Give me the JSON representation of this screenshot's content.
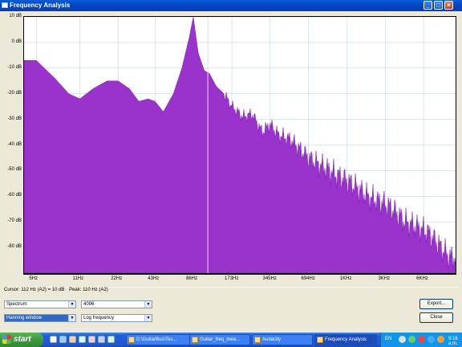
{
  "window": {
    "title": "Frequency Analysis"
  },
  "title_buttons": {
    "minimize": "_",
    "maximize": "□",
    "close": "×"
  },
  "chart_data": {
    "type": "area",
    "y_ticks": [
      "10 dB",
      "0 dB",
      "-10 dB",
      "-20 dB",
      "-30 dB",
      "-40 dB",
      "-50 dB",
      "-60 dB",
      "-70 dB",
      "-80 dB"
    ],
    "x_ticks": [
      "5Hz",
      "11Hz",
      "22Hz",
      "43Hz",
      "86Hz",
      "173Hz",
      "345Hz",
      "694Hz",
      "1KHz",
      "3KHz",
      "6KHz"
    ],
    "ylim": [
      -90,
      10
    ],
    "x_scale": "log",
    "fill_color": "#9933cc",
    "grid": true,
    "cursor_hz": 112,
    "spectrum_envelope_db": [
      [
        5,
        -7
      ],
      [
        7,
        -14
      ],
      [
        9,
        -20
      ],
      [
        11,
        -22
      ],
      [
        14,
        -18
      ],
      [
        18,
        -15
      ],
      [
        22,
        -15
      ],
      [
        27,
        -18
      ],
      [
        32,
        -23
      ],
      [
        38,
        -22
      ],
      [
        43,
        -23
      ],
      [
        50,
        -27
      ],
      [
        60,
        -20
      ],
      [
        70,
        -10
      ],
      [
        80,
        2
      ],
      [
        86,
        10
      ],
      [
        94,
        -4
      ],
      [
        105,
        -11
      ],
      [
        115,
        -12
      ],
      [
        130,
        -17
      ],
      [
        150,
        -20
      ],
      [
        173,
        -25
      ],
      [
        210,
        -29
      ],
      [
        250,
        -28
      ],
      [
        300,
        -35
      ],
      [
        345,
        -32
      ],
      [
        400,
        -36
      ],
      [
        500,
        -38
      ],
      [
        694,
        -45
      ],
      [
        1000,
        -50
      ],
      [
        1500,
        -55
      ],
      [
        2000,
        -60
      ],
      [
        3000,
        -64
      ],
      [
        4000,
        -70
      ],
      [
        6000,
        -74
      ],
      [
        9000,
        -84
      ]
    ]
  },
  "status": {
    "cursor": "Cursor: 112 Hz (A2) = 10 dB",
    "peak": "Peak: 110 Hz (A2)"
  },
  "controls": {
    "algorithm": "Spectrum",
    "size": "4096",
    "window_func": "Hanning window",
    "axis": "Log frequency",
    "export_label": "Export...",
    "close_label": "Close"
  },
  "taskbar": {
    "start_label": "start",
    "tasks": [
      {
        "label": "D:\\GuitarBus\\Tes..."
      },
      {
        "label": "Guitar_freq_mea..."
      },
      {
        "label": "Audacity"
      },
      {
        "label": "Frequency Analysis"
      }
    ],
    "lang": "EN",
    "clock": "9:16 a.m."
  }
}
